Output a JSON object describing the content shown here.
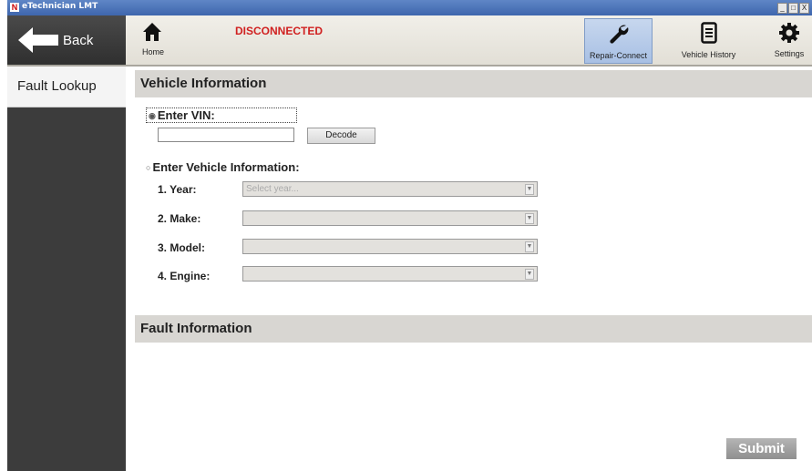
{
  "window": {
    "title": "eTechnician LMT",
    "controls": [
      "_",
      "□",
      "X"
    ]
  },
  "toolbar": {
    "back_label": "Back",
    "home_label": "Home",
    "status": "DISCONNECTED",
    "repair_connect_label": "Repair-Connect",
    "vehicle_history_label": "Vehicle History",
    "settings_label": "Settings"
  },
  "sidebar": {
    "items": [
      {
        "label": "Fault Lookup"
      }
    ]
  },
  "vehicle_info": {
    "header": "Vehicle Information",
    "vin_option_label": "Enter VIN:",
    "vin_value": "",
    "decode_label": "Decode",
    "vehicle_option_label": "Enter Vehicle Information:",
    "fields": [
      {
        "label": "1. Year:",
        "value": "Select year..."
      },
      {
        "label": "2. Make:",
        "value": ""
      },
      {
        "label": "3. Model:",
        "value": ""
      },
      {
        "label": "4. Engine:",
        "value": ""
      }
    ]
  },
  "fault_info": {
    "header": "Fault Information",
    "submit_label": "Submit"
  },
  "colors": {
    "status": "#d02020",
    "sidebar": "#3c3c3c",
    "section_header": "#d8d6d2",
    "titlebar": "#3e66ad"
  }
}
